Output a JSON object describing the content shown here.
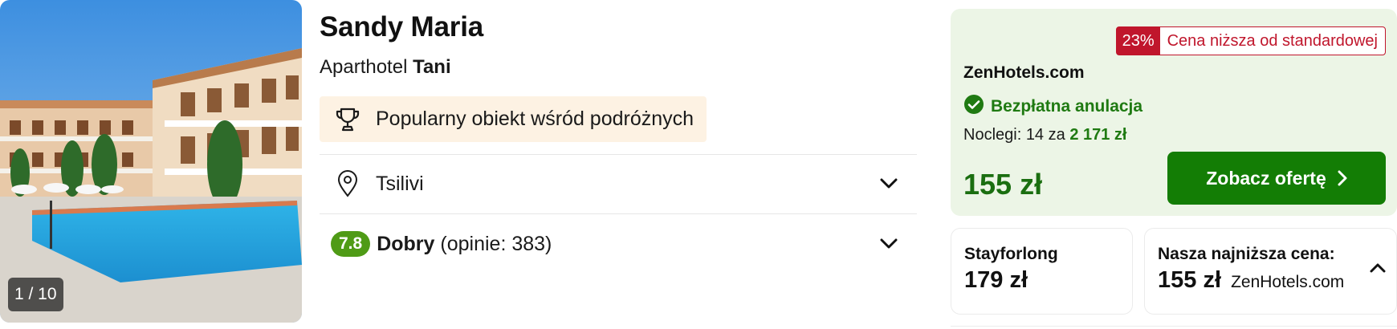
{
  "photo": {
    "counter": "1 / 10"
  },
  "hotel": {
    "name": "Sandy Maria",
    "type": "Aparthotel",
    "category": "Tani",
    "popular_label": "Popularny obiekt wśród podróżnych",
    "location": "Tsilivi",
    "rating": {
      "score": "7.8",
      "word": "Dobry",
      "count_text": "(opinie: 383)"
    }
  },
  "offer": {
    "discount_pct": "23%",
    "discount_msg": "Cena niższa od standardowej",
    "provider": "ZenHotels.com",
    "cancellation": "Bezpłatna anulacja",
    "nights_prefix": "Noclegi: 14 za",
    "nights_total": "2 171 zł",
    "price": "155 zł",
    "cta_label": "Zobacz ofertę"
  },
  "compare": [
    {
      "title": "Stayforlong",
      "price": "179 zł"
    },
    {
      "title": "Nasza najniższa cena:",
      "price": "155 zł",
      "source": "ZenHotels.com"
    }
  ],
  "colors": {
    "accent_green": "#137d05",
    "discount_red": "#c0162c",
    "offer_bg": "#ecf5e6",
    "popular_bg": "#fdf2e3",
    "score_green": "#4f9b16"
  }
}
